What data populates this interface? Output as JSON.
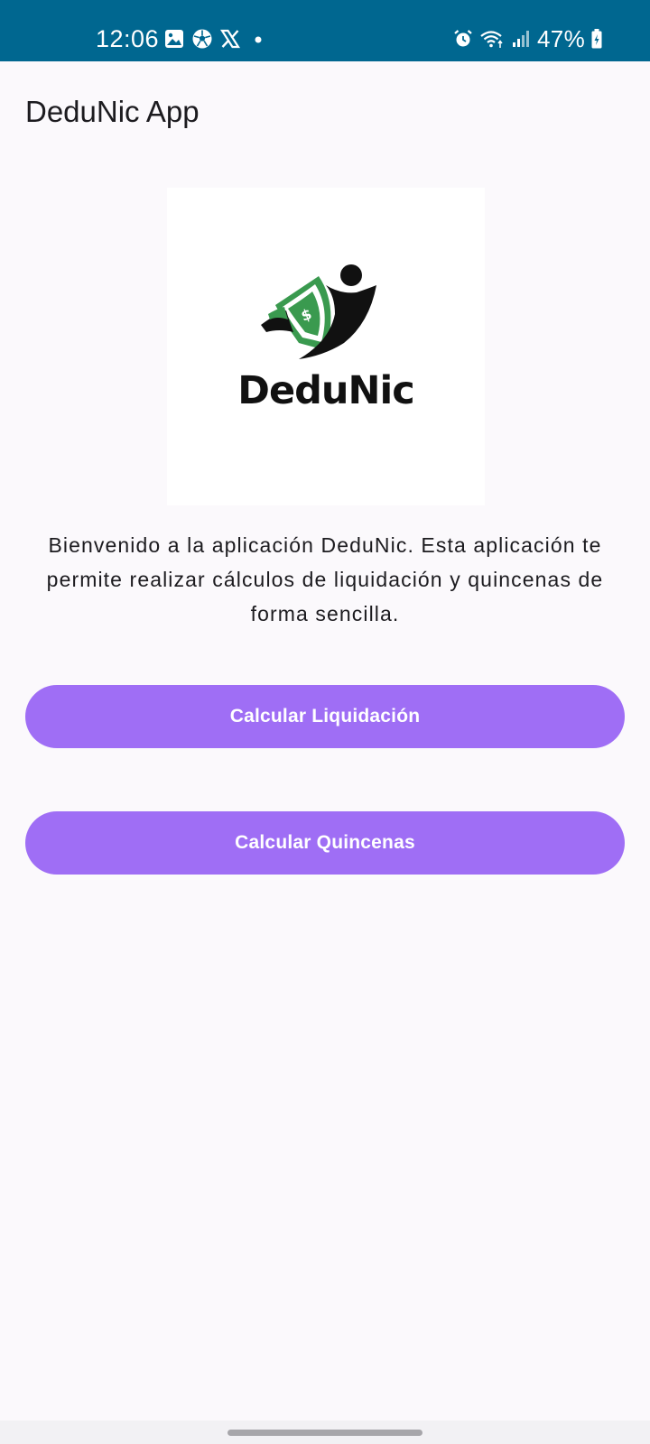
{
  "status_bar": {
    "time": "12:06",
    "battery": "47%",
    "background": "#006790",
    "left_icons": [
      "gallery-icon",
      "soccer-ball-icon",
      "x-logo-icon",
      "dot-icon"
    ],
    "right_icons": [
      "alarm-icon",
      "wifi-icon",
      "signal-icon",
      "battery-charging-icon"
    ]
  },
  "app_bar": {
    "title": "DeduNic App"
  },
  "logo": {
    "wordmark": "DeduNic",
    "accent_color": "#3a9a4f"
  },
  "main": {
    "welcome_text": "Bienvenido a la aplicación DeduNic. Esta aplicación te permite realizar cálculos de liquidación y quincenas de forma sencilla.",
    "buttons": {
      "liquidacion": "Calcular Liquidación",
      "quincenas": "Calcular Quincenas"
    },
    "button_color": "#9f6ef5"
  }
}
